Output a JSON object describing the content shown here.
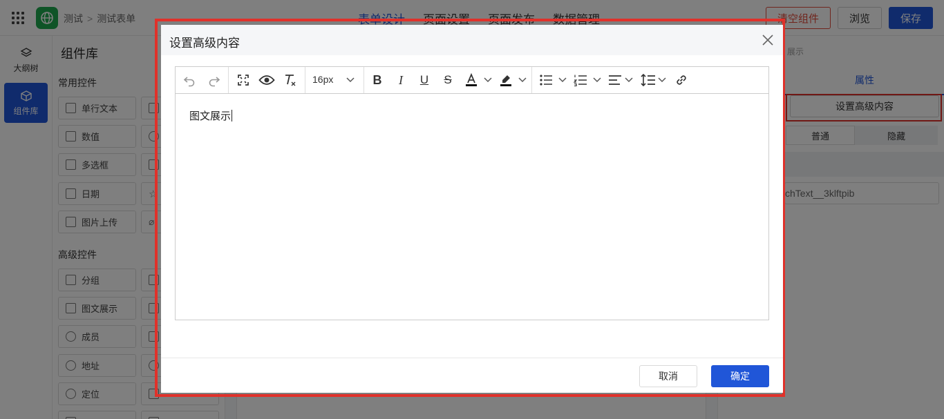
{
  "header": {
    "breadcrumb": [
      "测试",
      "测试表单"
    ],
    "tabs": [
      {
        "label": "表单设计",
        "active": true
      },
      {
        "label": "页面设置",
        "active": false
      },
      {
        "label": "页面发布",
        "active": false
      },
      {
        "label": "数据管理",
        "active": false
      }
    ],
    "clear_label": "清空组件",
    "preview_label": "浏览",
    "save_label": "保存"
  },
  "rail": {
    "items": [
      {
        "label": "大纲树",
        "icon": "layers-icon",
        "active": false
      },
      {
        "label": "组件库",
        "icon": "cube-icon",
        "active": true
      }
    ]
  },
  "library": {
    "title": "组件库",
    "common_title": "常用控件",
    "common_items": [
      "单行文本",
      "数值",
      "多选框",
      "日期",
      "图片上传"
    ],
    "advanced_title": "高级控件",
    "advanced_items": [
      "分组",
      "图文展示",
      "成员",
      "地址",
      "定位"
    ]
  },
  "properties": {
    "crumb": "展示",
    "tab": "属性",
    "set_button": "设置高级内容",
    "segments": [
      "普通",
      "隐藏"
    ],
    "field_id": "chText__3klftpib"
  },
  "modal": {
    "title": "设置高级内容",
    "font_size": "16px",
    "content": "图文展示",
    "cancel_label": "取消",
    "ok_label": "确定"
  },
  "colors": {
    "primary": "#2056d8",
    "danger": "#e0312a",
    "logo": "#1fa84f"
  }
}
